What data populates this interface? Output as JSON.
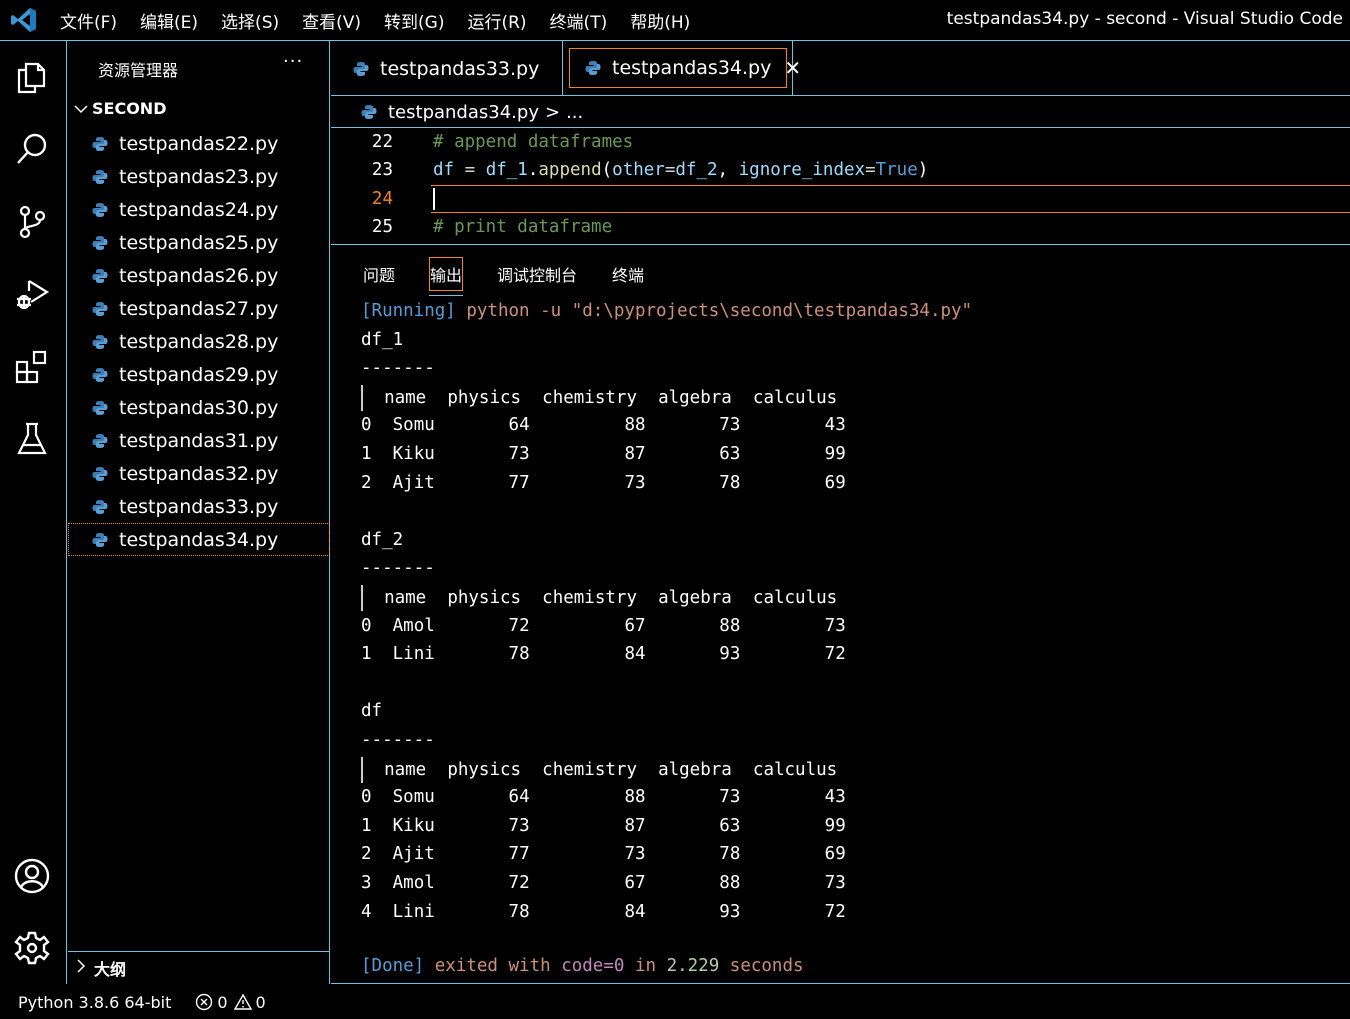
{
  "titlebar": {
    "menu": [
      "文件(F)",
      "编辑(E)",
      "选择(S)",
      "查看(V)",
      "转到(G)",
      "运行(R)",
      "终端(T)",
      "帮助(H)"
    ],
    "window_title": "testpandas34.py - second - Visual Studio Code"
  },
  "activitybar": {
    "icons": [
      "explorer-icon",
      "search-icon",
      "source-control-icon",
      "run-debug-icon",
      "extensions-icon",
      "testing-icon",
      "account-icon",
      "settings-gear-icon"
    ]
  },
  "sidebar": {
    "title": "资源管理器",
    "more": "···",
    "folder": "SECOND",
    "files": [
      "testpandas22.py",
      "testpandas23.py",
      "testpandas24.py",
      "testpandas25.py",
      "testpandas26.py",
      "testpandas27.py",
      "testpandas28.py",
      "testpandas29.py",
      "testpandas30.py",
      "testpandas31.py",
      "testpandas32.py",
      "testpandas33.py",
      "testpandas34.py"
    ],
    "selected_file": "testpandas34.py",
    "outline_label": "大纲"
  },
  "tabs": [
    {
      "label": "testpandas33.py",
      "active": false
    },
    {
      "label": "testpandas34.py",
      "active": true,
      "close": "✕"
    }
  ],
  "breadcrumb": {
    "file": "testpandas34.py",
    "separator": ">",
    "rest": "..."
  },
  "editor": {
    "lines": [
      {
        "number": "22",
        "comment": "# append dataframes"
      },
      {
        "number": "23",
        "tokens": [
          {
            "t": "df",
            "c": "var"
          },
          {
            "t": " = ",
            "c": "op"
          },
          {
            "t": "df_1",
            "c": "var"
          },
          {
            "t": ".",
            "c": "punc"
          },
          {
            "t": "append",
            "c": "fn"
          },
          {
            "t": "(",
            "c": "punc"
          },
          {
            "t": "other",
            "c": "var"
          },
          {
            "t": "=",
            "c": "op"
          },
          {
            "t": "df_2",
            "c": "var"
          },
          {
            "t": ", ",
            "c": "punc"
          },
          {
            "t": "ignore_index",
            "c": "var"
          },
          {
            "t": "=",
            "c": "op"
          },
          {
            "t": "True",
            "c": "kw"
          },
          {
            "t": ")",
            "c": "punc"
          }
        ]
      },
      {
        "number": "24",
        "current": true,
        "text": ""
      },
      {
        "number": "25",
        "comment": "# print dataframe"
      }
    ]
  },
  "panel": {
    "tabs": [
      "问题",
      "输出",
      "调试控制台",
      "终端"
    ],
    "active_tab": "输出",
    "running_tag": "[Running]",
    "running_cmd": " python -u \"d:\\pyprojects\\second\\testpandas34.py\"",
    "columns": [
      "name",
      "physics",
      "chemistry",
      "algebra",
      "calculus"
    ],
    "separator": "-------",
    "tables": [
      {
        "title": "df_1",
        "rows": [
          {
            "index": "0",
            "name": "Somu",
            "physics": "64",
            "chemistry": "88",
            "algebra": "73",
            "calculus": "43"
          },
          {
            "index": "1",
            "name": "Kiku",
            "physics": "73",
            "chemistry": "87",
            "algebra": "63",
            "calculus": "99"
          },
          {
            "index": "2",
            "name": "Ajit",
            "physics": "77",
            "chemistry": "73",
            "algebra": "78",
            "calculus": "69"
          }
        ]
      },
      {
        "title": "df_2",
        "rows": [
          {
            "index": "0",
            "name": "Amol",
            "physics": "72",
            "chemistry": "67",
            "algebra": "88",
            "calculus": "73"
          },
          {
            "index": "1",
            "name": "Lini",
            "physics": "78",
            "chemistry": "84",
            "algebra": "93",
            "calculus": "72"
          }
        ]
      },
      {
        "title": "df",
        "rows": [
          {
            "index": "0",
            "name": "Somu",
            "physics": "64",
            "chemistry": "88",
            "algebra": "73",
            "calculus": "43"
          },
          {
            "index": "1",
            "name": "Kiku",
            "physics": "73",
            "chemistry": "87",
            "algebra": "63",
            "calculus": "99"
          },
          {
            "index": "2",
            "name": "Ajit",
            "physics": "77",
            "chemistry": "73",
            "algebra": "78",
            "calculus": "69"
          },
          {
            "index": "3",
            "name": "Amol",
            "physics": "72",
            "chemistry": "67",
            "algebra": "88",
            "calculus": "73"
          },
          {
            "index": "4",
            "name": "Lini",
            "physics": "78",
            "chemistry": "84",
            "algebra": "93",
            "calculus": "72"
          }
        ]
      }
    ],
    "done": {
      "tag": "[Done]",
      "exited_with": " exited with ",
      "code": "code=0",
      "in": " in ",
      "time": "2.229",
      "seconds": " seconds"
    }
  },
  "statusbar": {
    "interpreter": "Python 3.8.6 64-bit",
    "errors": "0",
    "warnings": "0"
  },
  "colors": {
    "border": "#6fc3df",
    "focus": "#f38518",
    "comment": "#6a9955",
    "variable": "#9cdcfe",
    "keyword": "#569cd6",
    "string": "#ce9178"
  }
}
